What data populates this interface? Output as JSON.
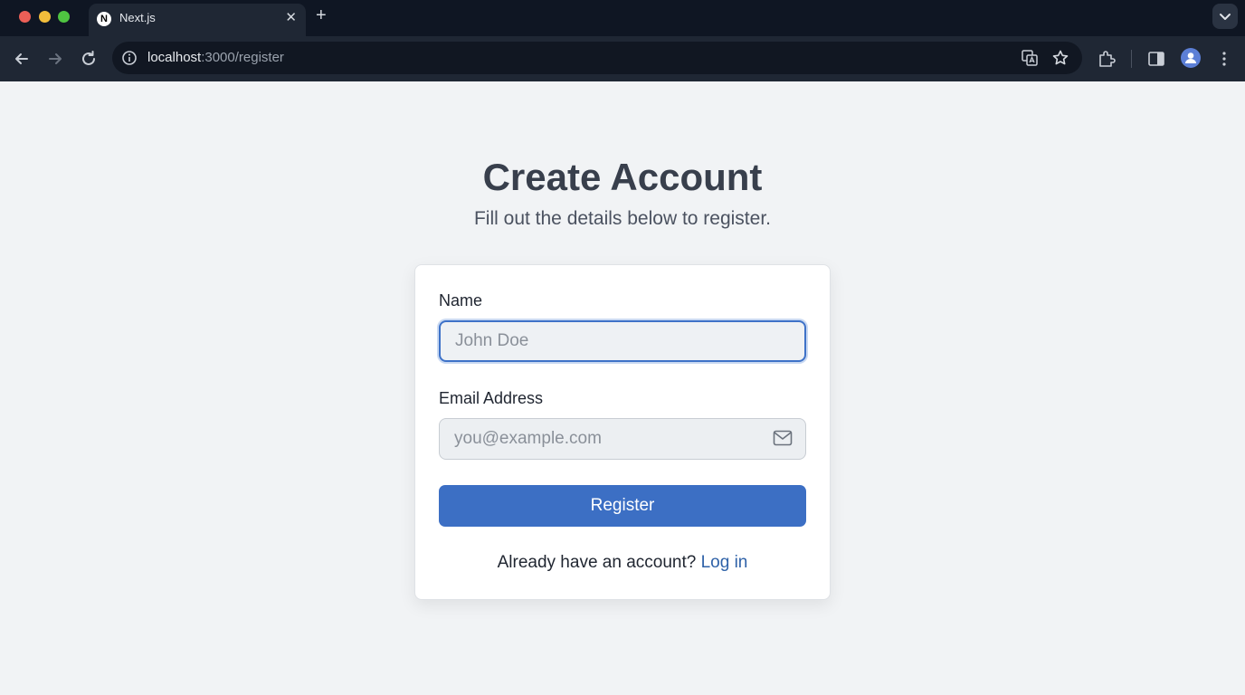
{
  "browser": {
    "tab_title": "Next.js",
    "tab_favicon": "N",
    "tab_close": "✕",
    "new_tab": "+",
    "url_host": "localhost",
    "url_path": ":3000/register",
    "icons": [
      "back-arrow-icon",
      "forward-arrow-icon",
      "reload-icon",
      "info-icon",
      "translate-icon",
      "star-icon",
      "extensions-icon",
      "sidebar-icon",
      "profile-icon",
      "menu-dots-icon",
      "chevron-down-icon"
    ]
  },
  "page": {
    "title": "Create Account",
    "subtitle": "Fill out the details below to register."
  },
  "form": {
    "name_label": "Name",
    "name_placeholder": "John Doe",
    "email_label": "Email Address",
    "email_placeholder": "you@example.com",
    "register_label": "Register",
    "login_prompt": "Already have an account?",
    "login_link": "Log in"
  },
  "colors": {
    "accent": "#3c6fc4",
    "link": "#2f62a8",
    "page_bg": "#f1f3f5",
    "chrome_bg": "#1f2734"
  }
}
